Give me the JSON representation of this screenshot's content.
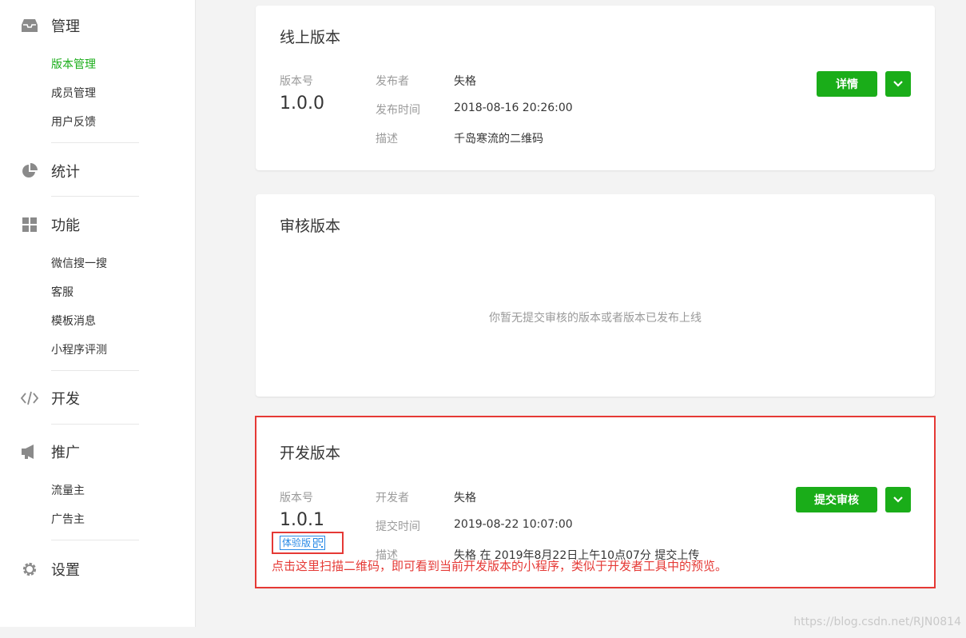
{
  "sidebar": {
    "sections": [
      {
        "icon": "inbox-icon",
        "title": "管理",
        "items": [
          "版本管理",
          "成员管理",
          "用户反馈"
        ],
        "active_item": "版本管理"
      },
      {
        "icon": "pie-chart-icon",
        "title": "统计",
        "items": []
      },
      {
        "icon": "grid-icon",
        "title": "功能",
        "items": [
          "微信搜一搜",
          "客服",
          "模板消息",
          "小程序评测"
        ]
      },
      {
        "icon": "code-icon",
        "title": "开发",
        "items": []
      },
      {
        "icon": "megaphone-icon",
        "title": "推广",
        "items": [
          "流量主",
          "广告主"
        ]
      },
      {
        "icon": "gear-icon",
        "title": "设置",
        "items": []
      }
    ]
  },
  "online": {
    "title": "线上版本",
    "version_label": "版本号",
    "version": "1.0.0",
    "publisher_label": "发布者",
    "publisher": "失格",
    "time_label": "发布时间",
    "time": "2018-08-16 20:26:00",
    "desc_label": "描述",
    "desc": "千岛寒流的二维码",
    "details_button": "详情"
  },
  "review": {
    "title": "审核版本",
    "empty_text": "你暂无提交审核的版本或者版本已发布上线"
  },
  "dev": {
    "title": "开发版本",
    "version_label": "版本号",
    "version": "1.0.1",
    "developer_label": "开发者",
    "developer": "失格",
    "time_label": "提交时间",
    "time": "2019-08-22 10:07:00",
    "desc_label": "描述",
    "desc": "失格 在 2019年8月22日上午10点07分 提交上传",
    "submit_button": "提交审核",
    "trial_tag": "体验版"
  },
  "annotation": "点击这里扫描二维码，即可看到当前开发版本的小程序，类似于开发者工具中的预览。",
  "watermark": "https://blog.csdn.net/RJN0814",
  "colors": {
    "accent": "#1aad19",
    "highlight": "#e53935",
    "trial": "#2a8ae6"
  }
}
